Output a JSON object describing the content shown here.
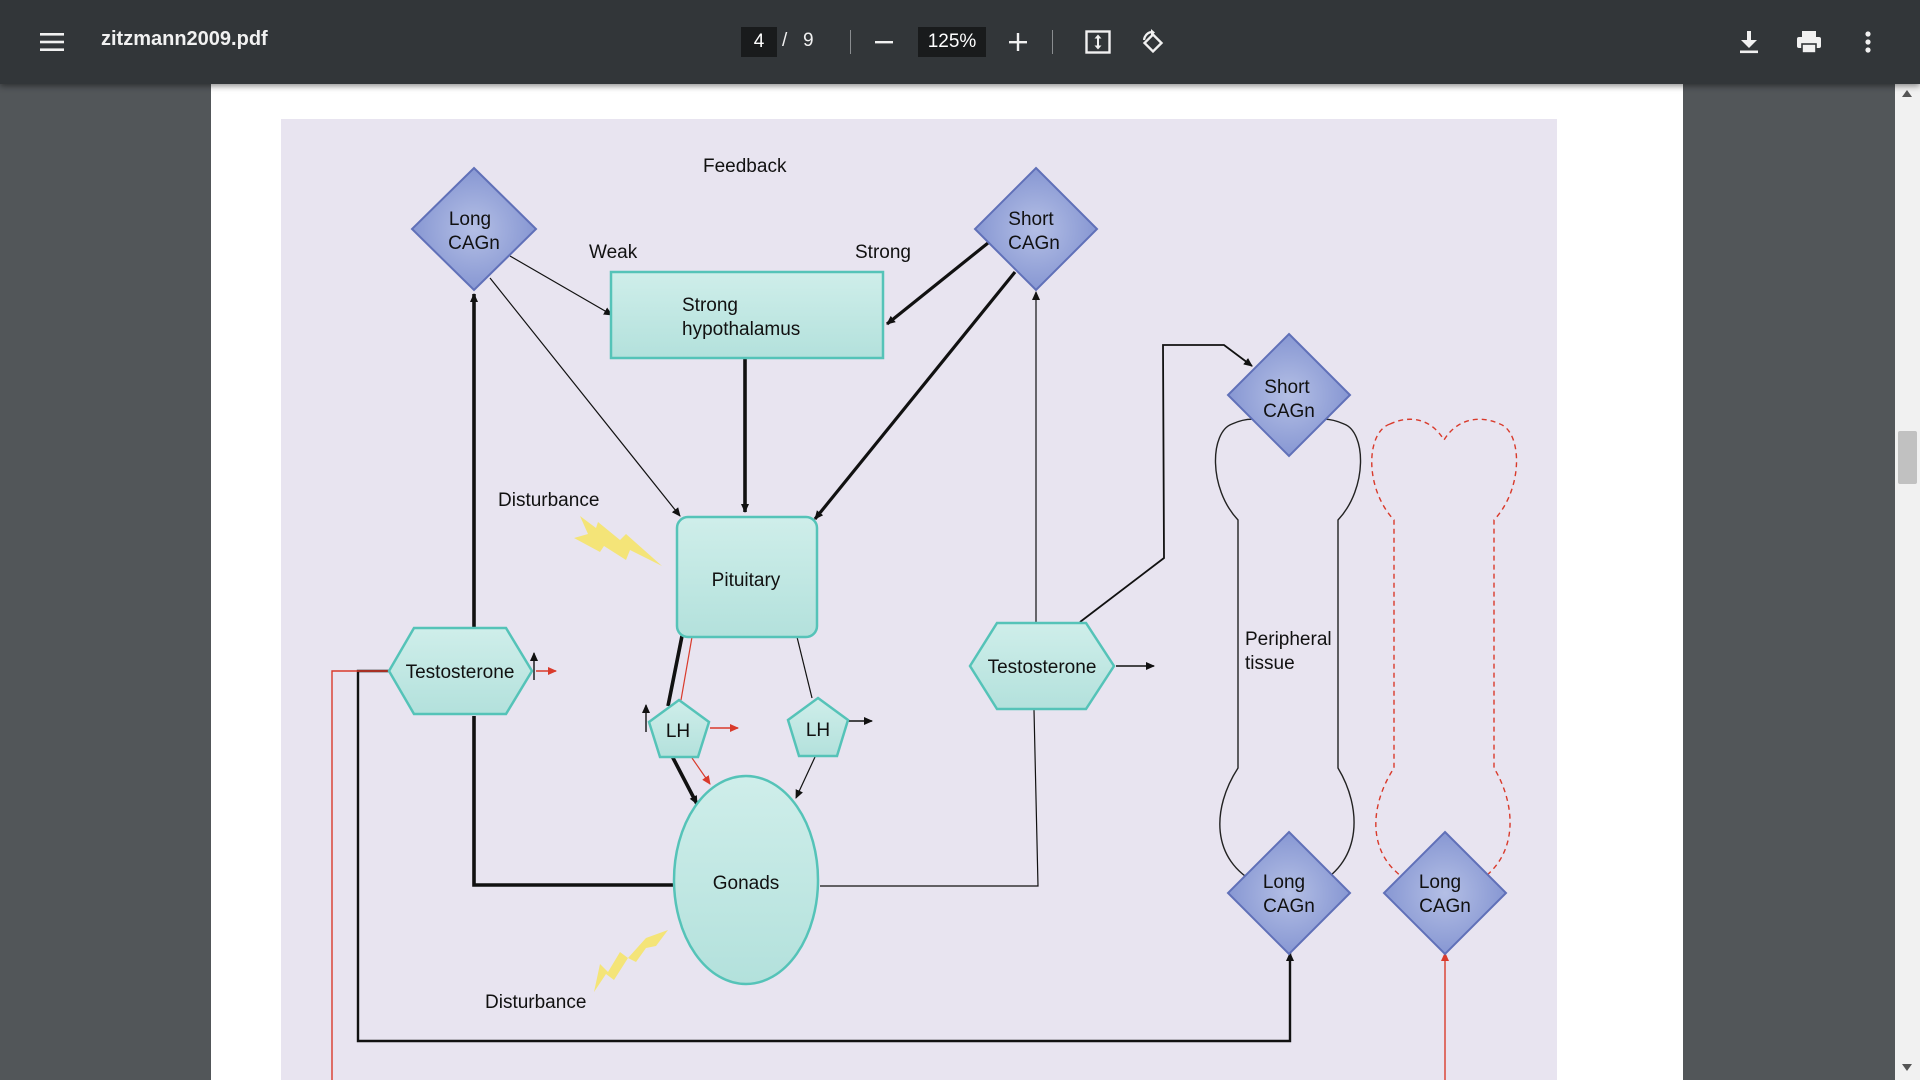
{
  "toolbar": {
    "file_name": "zitzmann2009.pdf",
    "current_page": "4",
    "page_separator": "/",
    "total_pages": "9",
    "zoom": "125%"
  },
  "diagram": {
    "feedback": "Feedback",
    "weak": "Weak",
    "strong": "Strong",
    "hypothalamus_line1": "Strong",
    "hypothalamus_line2": "hypothalamus",
    "pituitary": "Pituitary",
    "disturbance_top": "Disturbance",
    "disturbance_bottom": "Disturbance",
    "gonads": "Gonads",
    "lh_left": "LH",
    "lh_right": "LH",
    "testosterone_left": "Testosterone",
    "testosterone_right": "Testosterone",
    "long_cagn_top_l1": "Long",
    "long_cagn_top_l2": "CAGn",
    "short_cagn_top_l1": "Short",
    "short_cagn_top_l2": "CAGn",
    "short_cagn_bone_l1": "Short",
    "short_cagn_bone_l2": "CAGn",
    "long_cagn_bone_l1": "Long",
    "long_cagn_bone_l2": "CAGn",
    "long_cagn_bone2_l1": "Long",
    "long_cagn_bone2_l2": "CAGn",
    "peripheral_l1": "Peripheral",
    "peripheral_l2": "tissue"
  },
  "colors": {
    "diagram_bg": "#e8e4f0",
    "teal_fill": "#bfe6e3",
    "teal_stroke": "#55c3b8",
    "diamond_fill": "#9aa8d8",
    "diamond_stroke": "#6070b8",
    "disturbance_bolt": "#f5e36a",
    "red_line": "#d93a2b"
  },
  "icons": {
    "menu": "hamburger-menu-icon",
    "zoom_out": "minus-icon",
    "zoom_in": "plus-icon",
    "fit": "fit-to-page-icon",
    "rotate": "rotate-icon",
    "download": "download-icon",
    "print": "print-icon",
    "more": "more-vertical-icon"
  }
}
